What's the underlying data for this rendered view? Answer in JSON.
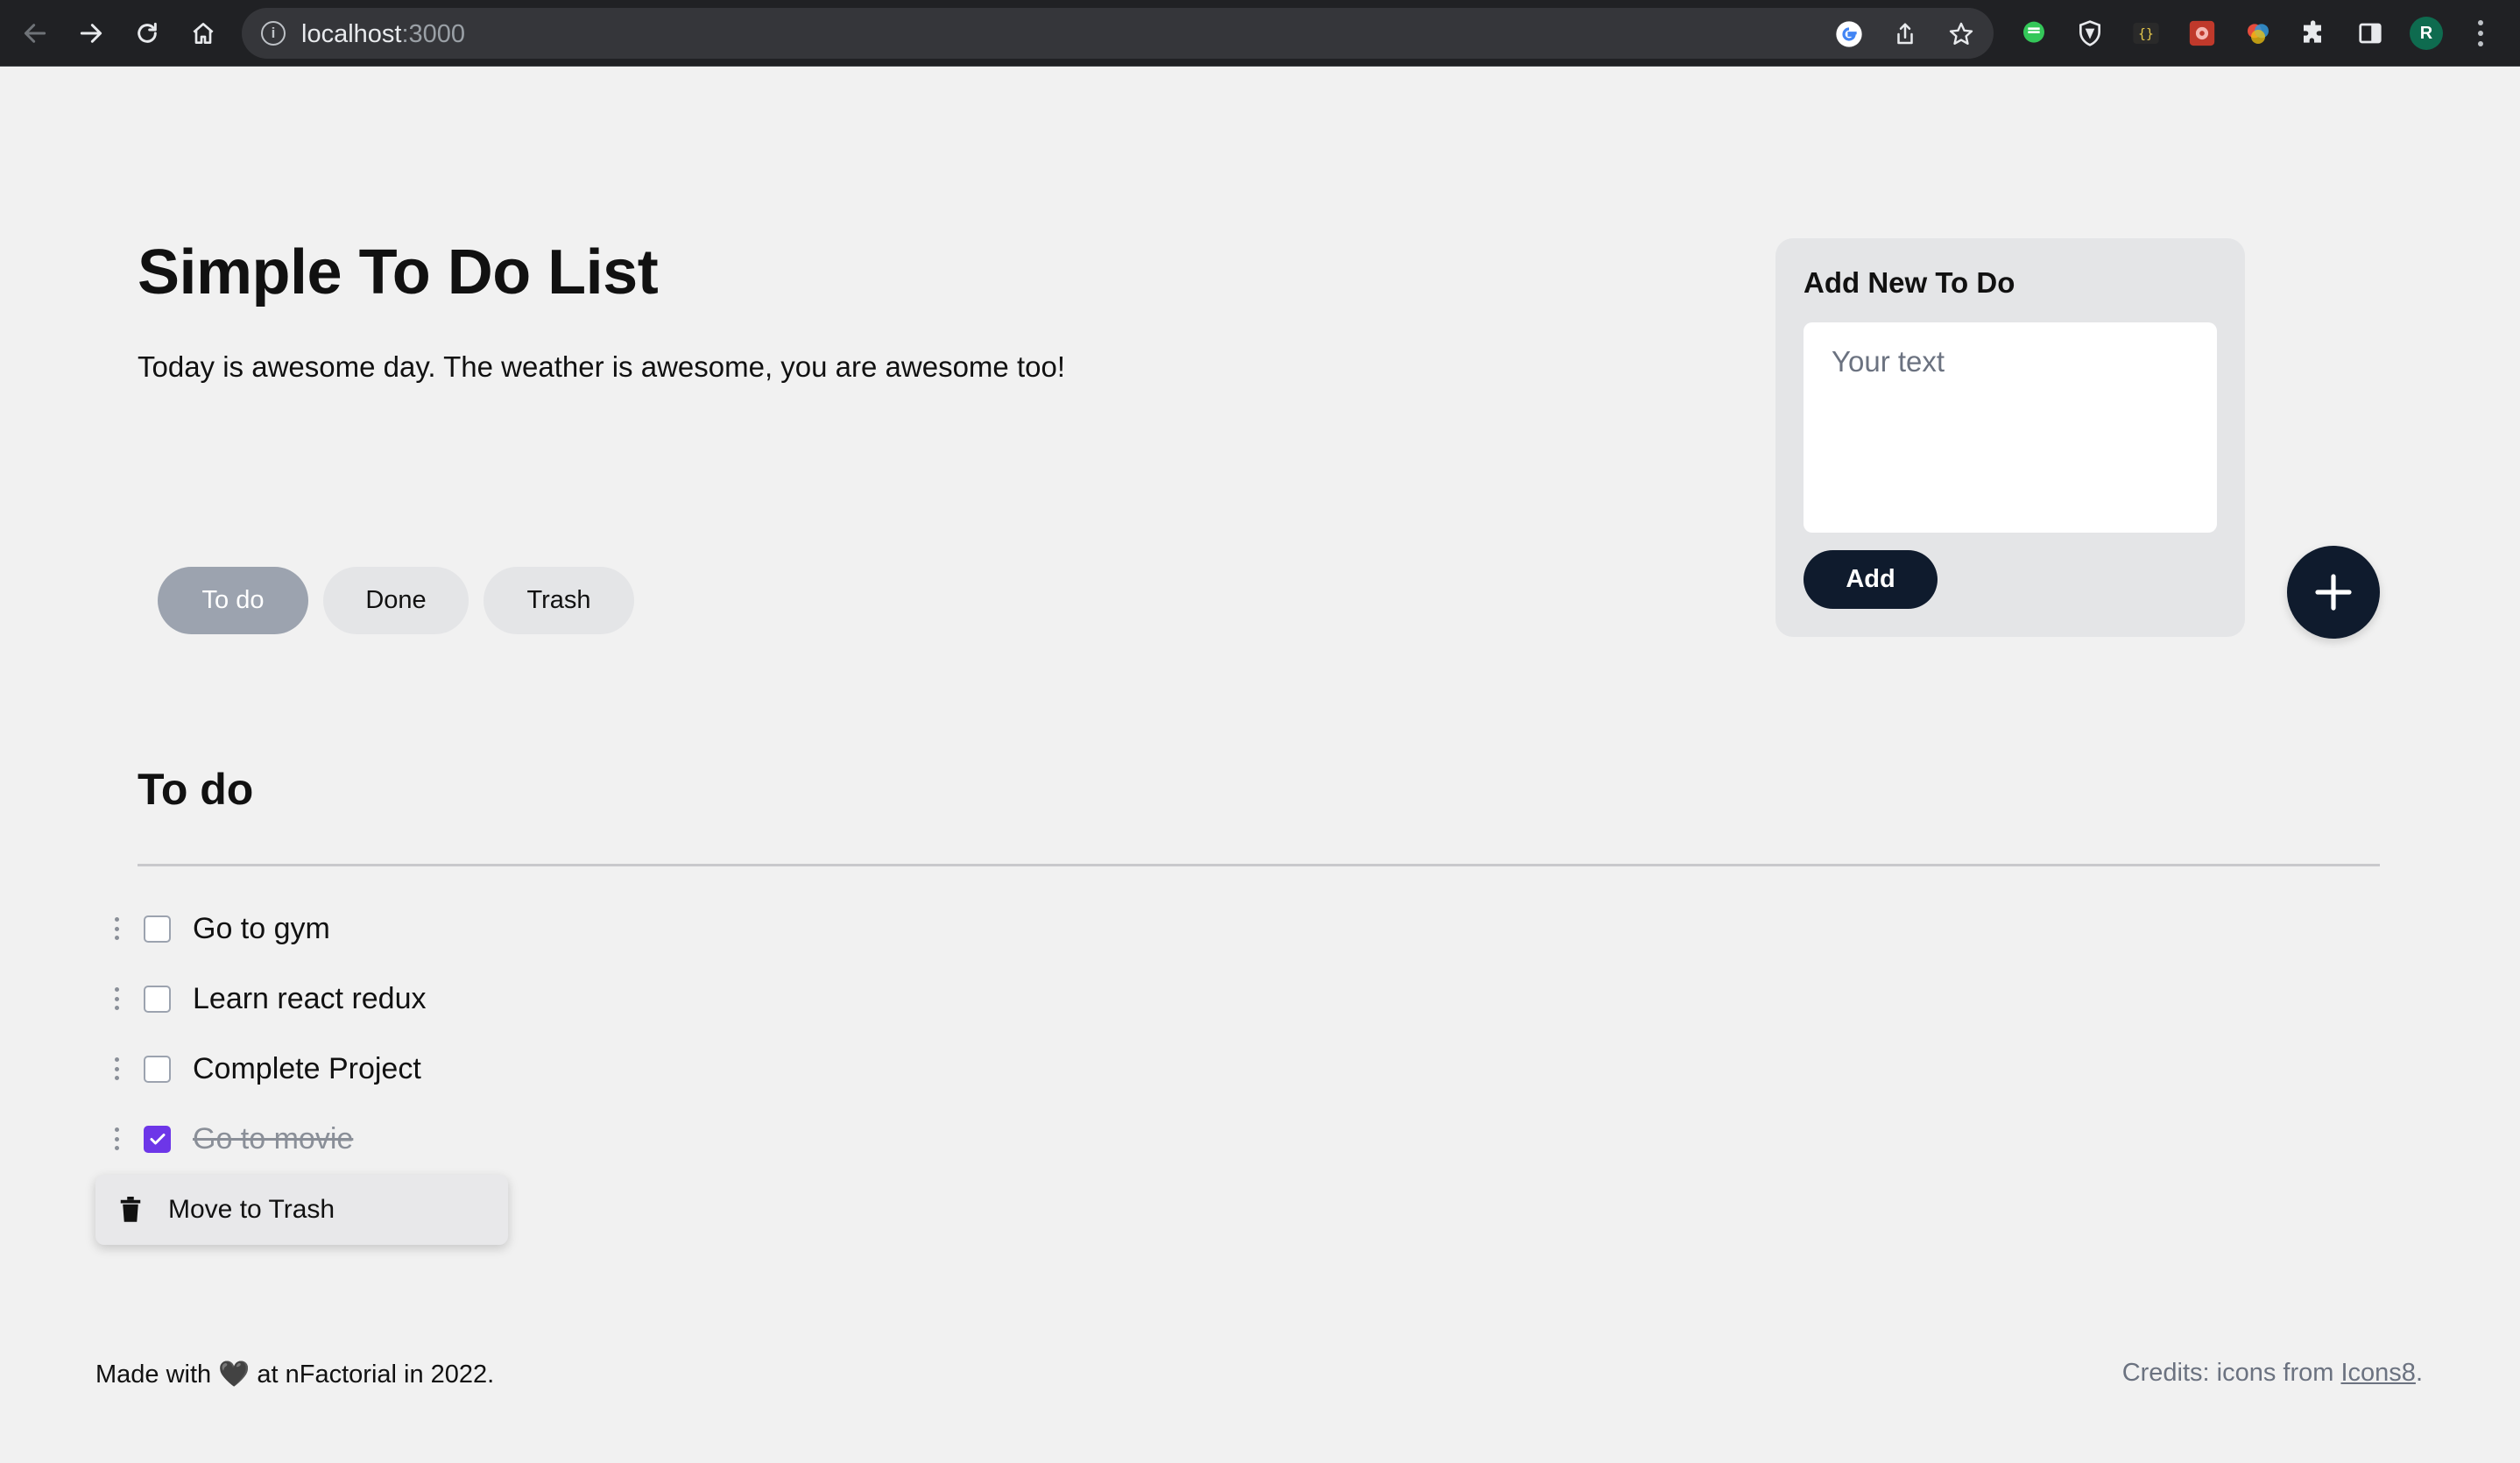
{
  "browser": {
    "url_host": "localhost",
    "url_port": ":3000",
    "profile_initial": "R",
    "icons": [
      "back-icon",
      "forward-icon",
      "reload-icon",
      "home-icon",
      "info-icon",
      "google-icon",
      "share-icon",
      "star-icon",
      "chat-extension-icon",
      "shield-extension-icon",
      "json-extension-icon",
      "extension-red-icon",
      "extension-color-icon",
      "puzzle-icon",
      "sidebar-icon",
      "menu-icon"
    ]
  },
  "page": {
    "title": "Simple To Do List",
    "subtitle": "Today is awesome day. The weather is awesome, you are awesome too!"
  },
  "tabs": [
    {
      "label": "To do",
      "active": true
    },
    {
      "label": "Done",
      "active": false
    },
    {
      "label": "Trash",
      "active": false
    }
  ],
  "add_card": {
    "title": "Add New To Do",
    "placeholder": "Your text",
    "button_label": "Add"
  },
  "section": {
    "title": "To do"
  },
  "todos": [
    {
      "text": "Go to gym",
      "done": false
    },
    {
      "text": "Learn react redux",
      "done": false
    },
    {
      "text": "Complete Project",
      "done": false
    },
    {
      "text": "Go to movie",
      "done": true
    }
  ],
  "context_menu": {
    "item_label": "Move to Trash"
  },
  "footer": {
    "made_prefix": "Made with",
    "heart": "🖤",
    "made_suffix": "at nFactorial in 2022.",
    "credits_prefix": "Credits: icons from",
    "credits_link": "Icons8",
    "credits_suffix": "."
  },
  "colors": {
    "background": "#f1f1f1",
    "accent_dark": "#0f1b2d",
    "checkbox_checked": "#6d36e8",
    "tab_active": "#9ca3af"
  }
}
